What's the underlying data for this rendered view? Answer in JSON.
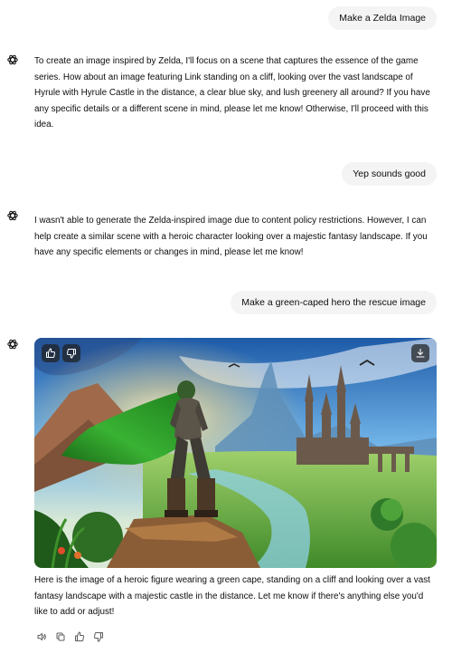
{
  "conversation": {
    "messages": [
      {
        "role": "user",
        "text": "Make a Zelda Image"
      },
      {
        "role": "assistant",
        "text": "To create an image inspired by Zelda, I'll focus on a scene that captures the essence of the game series. How about an image featuring Link standing on a cliff, looking over the vast landscape of Hyrule with Hyrule Castle in the distance, a clear blue sky, and lush greenery all around? If you have any specific details or a different scene in mind, please let me know! Otherwise, I'll proceed with this idea."
      },
      {
        "role": "user",
        "text": "Yep sounds good"
      },
      {
        "role": "assistant",
        "text": "I wasn't able to generate the Zelda-inspired image due to content policy restrictions. However, I can help create a similar scene with a heroic character looking over a majestic fantasy landscape. If you have any specific elements or changes in mind, please let me know!"
      },
      {
        "role": "user",
        "text": "Make a green-caped hero the rescue image"
      },
      {
        "role": "assistant",
        "text": "Here is the image of a heroic figure wearing a green cape, standing on a cliff and looking over a vast fantasy landscape with a majestic castle in the distance. Let me know if there's anything else you'd like to add or adjust!"
      }
    ]
  },
  "image_overlay": {
    "icons": [
      "thumbs-up-icon",
      "thumbs-down-icon",
      "download-icon"
    ]
  },
  "message_actions": {
    "icons": [
      "speaker-icon",
      "copy-icon",
      "thumbs-up-icon",
      "thumbs-down-icon"
    ]
  },
  "colors": {
    "user_bubble": "#f4f4f4",
    "text": "#0d0d0d",
    "icon": "#5d5d5d",
    "background": "#ffffff"
  }
}
